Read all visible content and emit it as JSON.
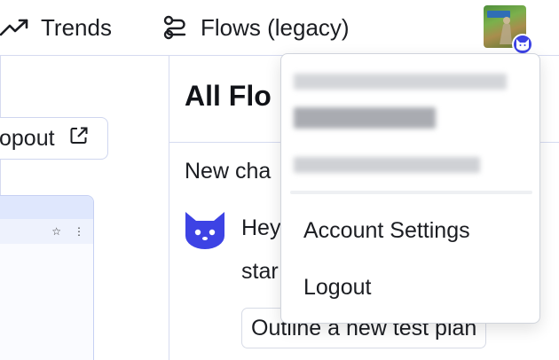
{
  "topnav": {
    "items": [
      {
        "label": "Trends",
        "icon": "trend-line-icon"
      },
      {
        "label": "Flows (legacy)",
        "icon": "flows-icon"
      }
    ]
  },
  "user": {
    "avatar_banner_text": "in speed"
  },
  "left_panel": {
    "popout_label": "opout",
    "browser_star": "☆",
    "browser_menu": "⋮"
  },
  "main": {
    "title": "All Flo",
    "new_chat": "New cha",
    "message_line1": "Hey",
    "message_line2": "star",
    "suggestion": "Outline a new test plan"
  },
  "dropdown": {
    "items": [
      {
        "label": "Account Settings"
      },
      {
        "label": "Logout"
      }
    ]
  },
  "colors": {
    "accent": "#3d43e4",
    "border": "#d6dbf0",
    "text": "#1b1d22"
  }
}
